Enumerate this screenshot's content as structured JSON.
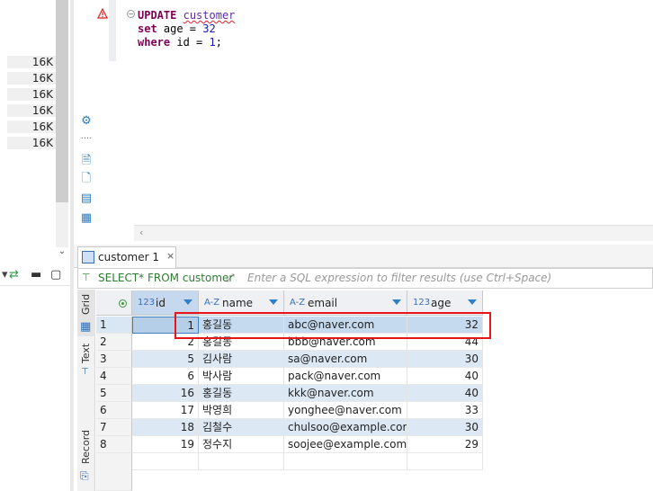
{
  "left_panel": {
    "sizes": [
      "16K",
      "16K",
      "16K",
      "16K",
      "16K",
      "16K"
    ]
  },
  "editor": {
    "lines": [
      {
        "kw": "UPDATE",
        "rest": "customer"
      },
      {
        "kw": "set",
        "rest": " age = ",
        "num": "32"
      },
      {
        "kw": "where",
        "rest": " id = ",
        "num": "1",
        "end": ";"
      }
    ]
  },
  "results": {
    "tab_label": "customer 1",
    "tab_close": "×",
    "filter_query": "SELECT* FROM customer",
    "filter_placeholder": "Enter a SQL expression to filter results (use Ctrl+Space)",
    "view_tabs": [
      "Grid",
      "Text",
      "Record"
    ],
    "columns": [
      {
        "type": "123",
        "name": "id"
      },
      {
        "type": "A-Z",
        "name": "name"
      },
      {
        "type": "A-Z",
        "name": "email"
      },
      {
        "type": "123",
        "name": "age"
      }
    ],
    "rows": [
      {
        "rn": "1",
        "id": "1",
        "name": "홍길동",
        "email": "abc@naver.com",
        "age": "32"
      },
      {
        "rn": "2",
        "id": "2",
        "name": "홍길동",
        "email": "bbb@naver.com",
        "age": "44"
      },
      {
        "rn": "3",
        "id": "5",
        "name": "김사람",
        "email": "sa@naver.com",
        "age": "30"
      },
      {
        "rn": "4",
        "id": "6",
        "name": "박사람",
        "email": "pack@naver.com",
        "age": "40"
      },
      {
        "rn": "5",
        "id": "16",
        "name": "홍길동",
        "email": "kkk@naver.com",
        "age": "40"
      },
      {
        "rn": "6",
        "id": "17",
        "name": "박영희",
        "email": "yonghee@naver.com",
        "age": "33"
      },
      {
        "rn": "7",
        "id": "18",
        "name": "김철수",
        "email": "chulsoo@example.com",
        "age": "30"
      },
      {
        "rn": "8",
        "id": "19",
        "name": "정수지",
        "email": "soojee@example.com",
        "age": "29"
      }
    ],
    "selected_row": 0
  },
  "colors": {
    "highlight_box": "#e8141a",
    "keyword": "#7f0055",
    "filter_query": "#2e7d32"
  }
}
